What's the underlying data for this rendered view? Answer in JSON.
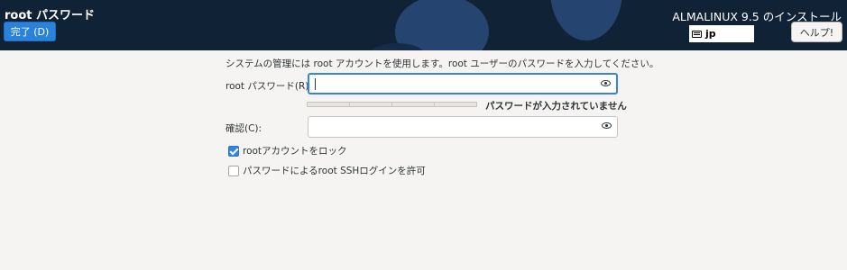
{
  "header": {
    "title": "root パスワード",
    "done_label": "完了 (D)",
    "product": "ALMALINUX 9.5 のインストール",
    "keyboard_layout": "jp",
    "keyboard_icon": "keyboard-icon",
    "help_label": "ヘルプ!"
  },
  "colors": {
    "header_bg": "#102336",
    "accent": "#2a82da",
    "focus": "#3584e4"
  },
  "form": {
    "intro": "システムの管理には root アカウントを使用します。root ユーザーのパスワードを入力してください。",
    "password_label": "root パスワード(R):",
    "password_value": "",
    "strength_text": "パスワードが入力されていません",
    "strength_level": 0,
    "confirm_label": "確認(C):",
    "confirm_value": "",
    "reveal_icon": "eye-icon",
    "lock_label": "rootアカウントをロック",
    "lock_checked": true,
    "ssh_label": "パスワードによるroot SSHログインを許可",
    "ssh_checked": false
  }
}
